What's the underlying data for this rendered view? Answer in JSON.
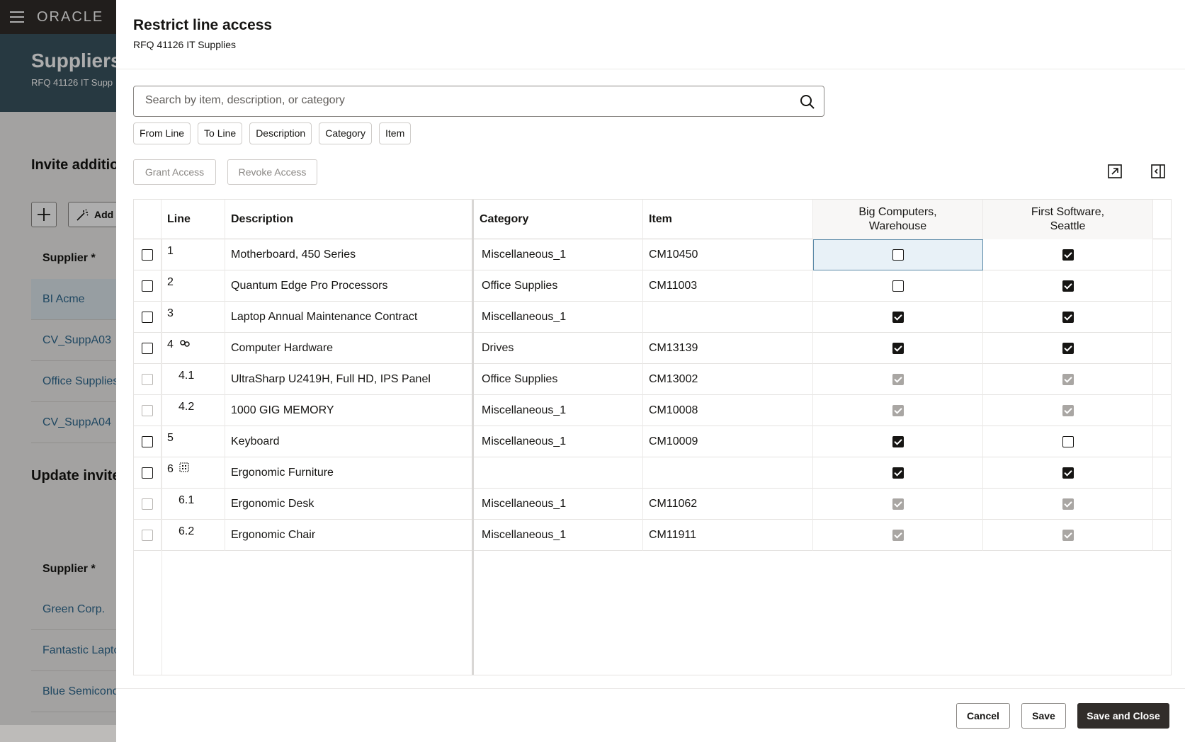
{
  "app": {
    "logo": "ORACLE"
  },
  "background": {
    "page_title": "Suppliers",
    "page_subtitle": "RFQ 41126 IT Supp",
    "section1": "Invite additio",
    "add_label": "Add :",
    "supplier_header": "Supplier *",
    "suppliers_top": [
      "BI Acme",
      "CV_SuppA03",
      "Office Supplies",
      "CV_SuppA04"
    ],
    "section2": "Update invite",
    "supplier_header2": "Supplier *",
    "suppliers_bottom": [
      "Green Corp.",
      "Fantastic Lapto",
      "Blue Semicond"
    ]
  },
  "drawer": {
    "title": "Restrict line access",
    "subtitle": "RFQ 41126 IT Supplies",
    "search": {
      "placeholder": "Search by item, description, or category",
      "value": ""
    },
    "filters": [
      "From Line",
      "To Line",
      "Description",
      "Category",
      "Item"
    ],
    "grant_label": "Grant Access",
    "revoke_label": "Revoke Access",
    "icons": {
      "search": "search-icon",
      "detach": "detach-icon",
      "collapse": "panel-collapse-icon"
    }
  },
  "table": {
    "headers": {
      "line": "Line",
      "description": "Description",
      "category": "Category",
      "item": "Item",
      "supplier1_line1": "Big Computers,",
      "supplier1_line2": "Warehouse",
      "supplier2_line1": "First Software,",
      "supplier2_line2": "Seattle"
    },
    "rows": [
      {
        "line": "1",
        "child": false,
        "icon": "",
        "description": "Motherboard, 450 Series",
        "category": "Miscellaneous_1",
        "item": "CM10450",
        "s1": false,
        "s2": true,
        "disabled": false
      },
      {
        "line": "2",
        "child": false,
        "icon": "",
        "description": "Quantum Edge Pro Processors",
        "category": "Office Supplies",
        "item": "CM11003",
        "s1": false,
        "s2": true,
        "disabled": false
      },
      {
        "line": "3",
        "child": false,
        "icon": "",
        "description": "Laptop Annual Maintenance Contract",
        "category": "Miscellaneous_1",
        "item": "",
        "s1": true,
        "s2": true,
        "disabled": false
      },
      {
        "line": "4",
        "child": false,
        "icon": "link",
        "description": "Computer Hardware",
        "category": "Drives",
        "item": "CM13139",
        "s1": true,
        "s2": true,
        "disabled": false
      },
      {
        "line": "4.1",
        "child": true,
        "icon": "",
        "description": "UltraSharp U2419H, Full HD, IPS Panel",
        "category": "Office Supplies",
        "item": "CM13002",
        "s1": true,
        "s2": true,
        "disabled": true
      },
      {
        "line": "4.2",
        "child": true,
        "icon": "",
        "description": "1000 GIG MEMORY",
        "category": "Miscellaneous_1",
        "item": "CM10008",
        "s1": true,
        "s2": true,
        "disabled": true
      },
      {
        "line": "5",
        "child": false,
        "icon": "",
        "description": "Keyboard",
        "category": "Miscellaneous_1",
        "item": "CM10009",
        "s1": true,
        "s2": false,
        "disabled": false
      },
      {
        "line": "6",
        "child": false,
        "icon": "group",
        "description": "Ergonomic Furniture",
        "category": "",
        "item": "",
        "s1": true,
        "s2": true,
        "disabled": false
      },
      {
        "line": "6.1",
        "child": true,
        "icon": "",
        "description": "Ergonomic Desk",
        "category": "Miscellaneous_1",
        "item": "CM11062",
        "s1": true,
        "s2": true,
        "disabled": true
      },
      {
        "line": "6.2",
        "child": true,
        "icon": "",
        "description": "Ergonomic Chair",
        "category": "Miscellaneous_1",
        "item": "CM11911",
        "s1": true,
        "s2": true,
        "disabled": true
      }
    ]
  },
  "footer": {
    "cancel": "Cancel",
    "save": "Save",
    "save_close": "Save and Close"
  }
}
